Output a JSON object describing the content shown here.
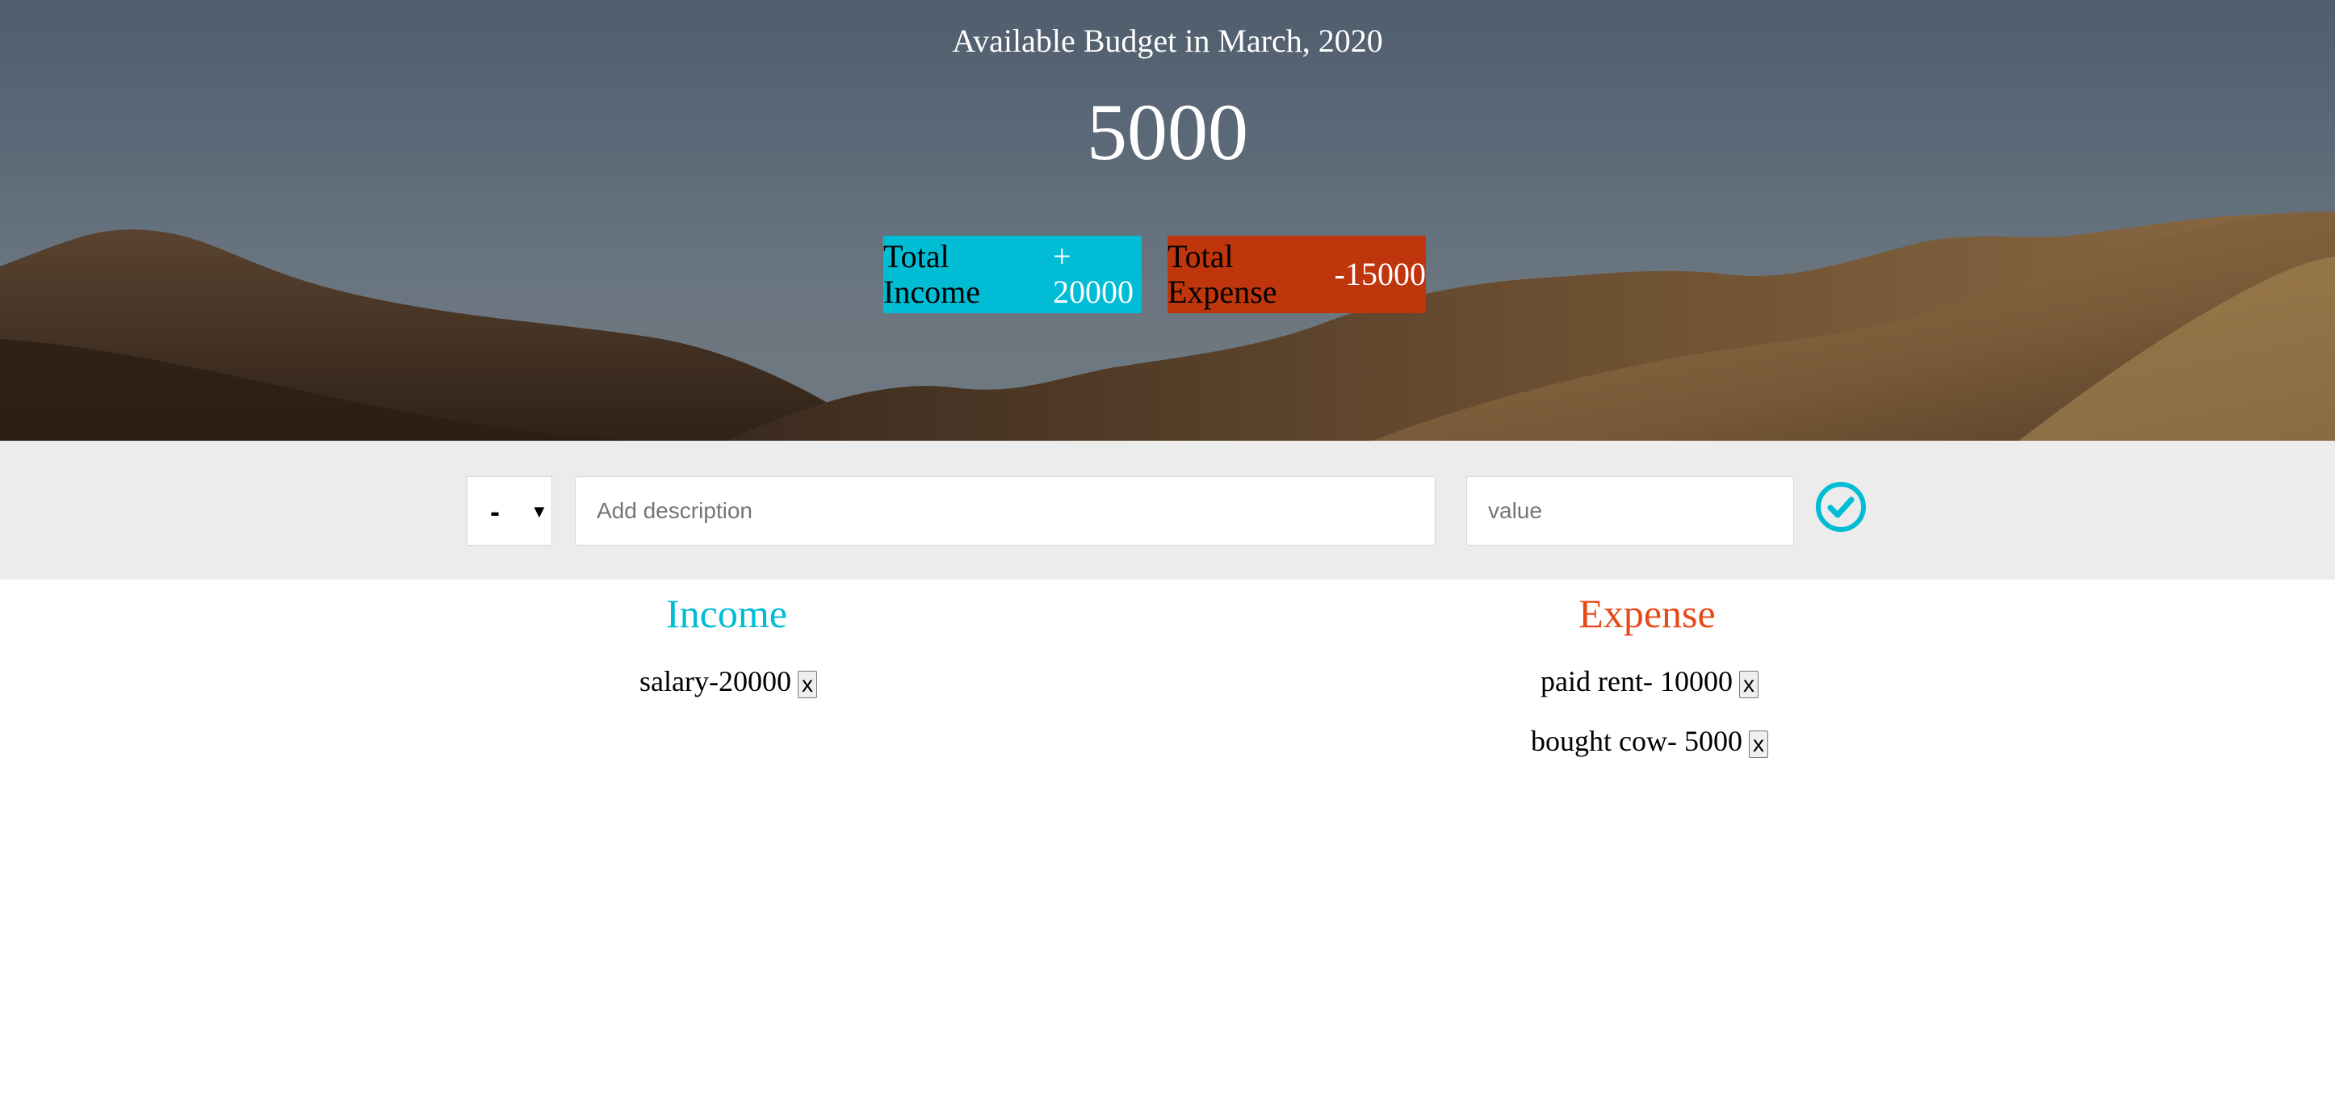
{
  "header": {
    "title": "Available Budget in March, 2020",
    "budget": "5000",
    "income": {
      "label": "Total Income",
      "value": "+ 20000"
    },
    "expense": {
      "label": "Total Expense",
      "value": "-15000"
    }
  },
  "add_form": {
    "type_selected": "-",
    "description_placeholder": "Add description",
    "value_placeholder": "value",
    "submit_icon": "check-circle-icon"
  },
  "income": {
    "title": "Income",
    "items": [
      {
        "text": "salary-20000",
        "delete_label": "x"
      }
    ]
  },
  "expense": {
    "title": "Expense",
    "items": [
      {
        "text": "paid rent- 10000",
        "delete_label": "x"
      },
      {
        "text": "bought cow- 5000",
        "delete_label": "x"
      }
    ]
  },
  "colors": {
    "income_accent": "#00bcd4",
    "expense_accent": "#bf360c",
    "expense_title": "#e64a19",
    "form_background": "#ececec"
  }
}
